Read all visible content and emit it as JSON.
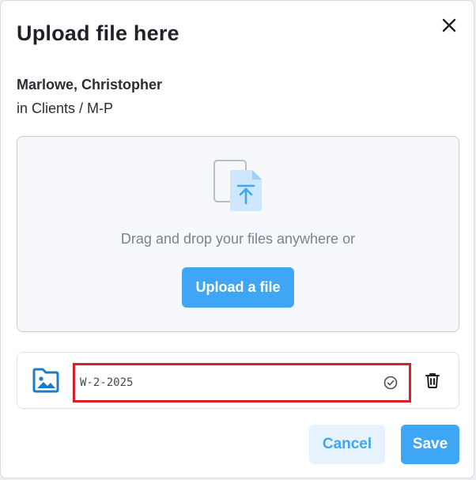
{
  "dialog": {
    "title": "Upload file here",
    "client_name": "Marlowe, Christopher",
    "client_path": "in Clients / M-P"
  },
  "dropzone": {
    "prompt": "Drag and drop your files anywhere or",
    "upload_label": "Upload a file",
    "icon": "file-upload-icon"
  },
  "file": {
    "name_value": "W-2-2025",
    "file_icon": "image-folder-icon",
    "status_icon": "check-circle-icon",
    "delete_icon": "trash-icon"
  },
  "footer": {
    "cancel_label": "Cancel",
    "save_label": "Save"
  },
  "colors": {
    "accent": "#3fa6f5",
    "accent_light": "#e6f3fe",
    "highlight_border": "#d8202a",
    "file_icon": "#1f7bc4"
  }
}
